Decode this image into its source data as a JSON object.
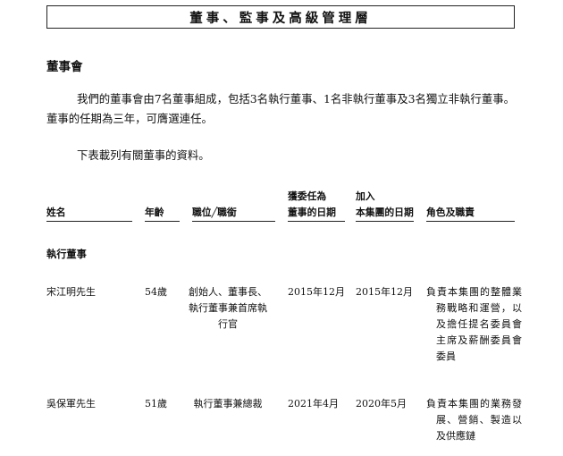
{
  "header": {
    "title": "董事、監事及高級管理層"
  },
  "section": {
    "title": "董事會",
    "paragraphs": [
      "我們的董事會由7名董事組成，包括3名執行董事、1名非執行董事及3名獨立非執行董事。董事的任期為三年，可膺選連任。",
      "下表載列有關董事的資料。"
    ]
  },
  "table": {
    "headers": [
      {
        "lines": [
          "姓名"
        ]
      },
      {
        "lines": [
          "年齡"
        ]
      },
      {
        "lines": [
          "職位╱職銜"
        ]
      },
      {
        "lines": [
          "獲委任為",
          "董事的日期"
        ]
      },
      {
        "lines": [
          "加入",
          "本集團的日期"
        ]
      },
      {
        "lines": [
          "角色及職責"
        ]
      }
    ],
    "group_label": "執行董事",
    "rows": [
      {
        "name": "宋江明先生",
        "age": "54歲",
        "position": "創始人、董事長、執行董事兼首席執行官",
        "appointed": "2015年12月",
        "joined": "2015年12月",
        "roles": "負責本集團的整體業務戰略和運營，以及擔任提名委員會主席及薪酬委員會委員"
      },
      {
        "name": "吳保軍先生",
        "age": "51歲",
        "position": "執行董事兼總裁",
        "appointed": "2021年4月",
        "joined": "2020年5月",
        "roles": "負責本集團的業務發展、營銷、製造以及供應鏈"
      }
    ]
  }
}
